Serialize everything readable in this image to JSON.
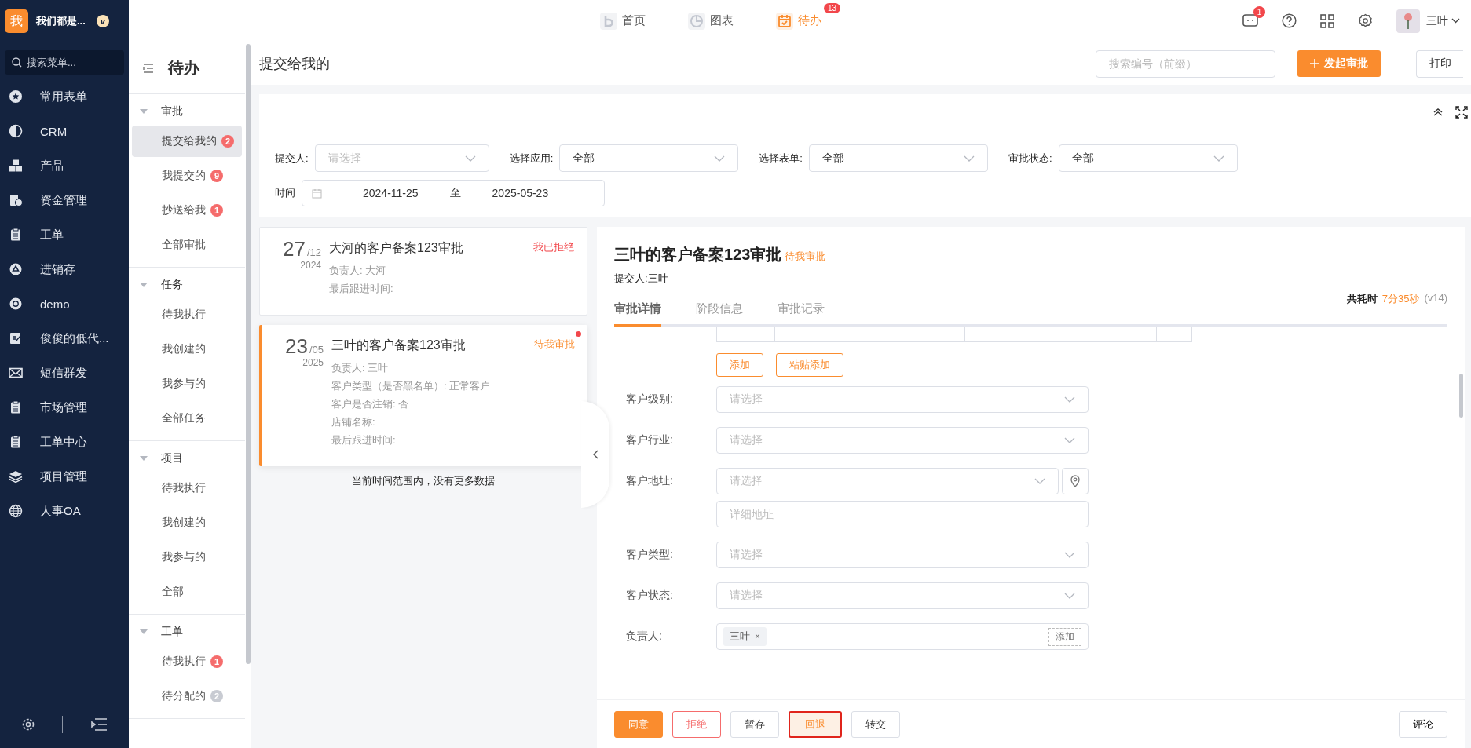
{
  "app": {
    "logo_char": "我",
    "name": "我们都是...",
    "badge": "v"
  },
  "menu_search": {
    "placeholder": "搜索菜单..."
  },
  "nav": [
    {
      "label": "常用表单",
      "kind": "star"
    },
    {
      "label": "CRM",
      "kind": "pie"
    },
    {
      "label": "产品",
      "kind": "boxes"
    },
    {
      "label": "资金管理",
      "kind": "money"
    },
    {
      "label": "工单",
      "kind": "clipboard"
    },
    {
      "label": "进销存",
      "kind": "cycle"
    },
    {
      "label": "demo",
      "kind": "aperture"
    },
    {
      "label": "俊俊的低代...",
      "kind": "edit"
    },
    {
      "label": "短信群发",
      "kind": "mail"
    },
    {
      "label": "市场管理",
      "kind": "clipboard"
    },
    {
      "label": "工单中心",
      "kind": "clipboard"
    },
    {
      "label": "项目管理",
      "kind": "layers"
    },
    {
      "label": "人事OA",
      "kind": "globe"
    }
  ],
  "top_tabs": [
    {
      "label": "首页",
      "kind": "home",
      "selected": false
    },
    {
      "label": "图表",
      "kind": "chart",
      "selected": false
    },
    {
      "label": "待办",
      "kind": "calendar",
      "selected": true,
      "badge": "13"
    }
  ],
  "header_right": {
    "message_badge": "1",
    "user": "三叶"
  },
  "subnav": {
    "title": "待办",
    "groups": [
      {
        "label": "审批",
        "expanded": true,
        "children": [
          {
            "label": "提交给我的",
            "selected": true,
            "badge": "2",
            "color": "#f56c6c"
          },
          {
            "label": "我提交的",
            "selected": false,
            "badge": "9",
            "color": "#f56c6c"
          },
          {
            "label": "抄送给我",
            "selected": false,
            "badge": "1",
            "color": "#f56c6c"
          },
          {
            "label": "全部审批",
            "selected": false
          }
        ]
      },
      {
        "label": "任务",
        "expanded": true,
        "children": [
          {
            "label": "待我执行",
            "selected": false
          },
          {
            "label": "我创建的",
            "selected": false
          },
          {
            "label": "我参与的",
            "selected": false
          },
          {
            "label": "全部任务",
            "selected": false
          }
        ]
      },
      {
        "label": "项目",
        "expanded": true,
        "children": [
          {
            "label": "待我执行",
            "selected": false
          },
          {
            "label": "我创建的",
            "selected": false
          },
          {
            "label": "我参与的",
            "selected": false
          },
          {
            "label": "全部",
            "selected": false
          }
        ]
      },
      {
        "label": "工单",
        "expanded": true,
        "children": [
          {
            "label": "待我执行",
            "selected": false,
            "badge": "1",
            "color": "#f56c6c"
          },
          {
            "label": "待分配的",
            "selected": false,
            "badge": "2",
            "color": "#c8cbd2"
          }
        ]
      }
    ]
  },
  "page_title": "提交给我的",
  "search": {
    "placeholder": "搜索编号（前缀）"
  },
  "start_button": "发起审批",
  "print_button": "打印",
  "filters": [
    {
      "label": "提交人:",
      "placeholder": "请选择"
    },
    {
      "label": "选择应用:",
      "value": "全部"
    },
    {
      "label": "选择表单:",
      "value": "全部"
    },
    {
      "label": "审批状态:",
      "value": "全部"
    }
  ],
  "time_filter": {
    "label": "时间",
    "start": "2024-11-25",
    "separator": "至",
    "end": "2025-05-23"
  },
  "cards": [
    {
      "day": "27",
      "month": "/12",
      "year": "2024",
      "title": "大河的客户备案123审批",
      "status": "我已拒绝",
      "color": "#f2474b",
      "selected": false,
      "unread": false,
      "fields": [
        "负责人: 大河",
        "最后跟进时间:"
      ]
    },
    {
      "day": "23",
      "month": "/05",
      "year": "2025",
      "title": "三叶的客户备案123审批",
      "status": "待我审批",
      "color": "#fa8c2e",
      "selected": true,
      "unread": true,
      "fields": [
        "负责人: 三叶",
        "客户类型（是否黑名单）: 正常客户",
        "客户是否注销: 否",
        "店铺名称:",
        "最后跟进时间:"
      ]
    }
  ],
  "list_end": "当前时间范围内，没有更多数据",
  "detail": {
    "title": "三叶的客户备案123审批",
    "status": "待我审批",
    "submitter": "提交人:三叶",
    "tabs": [
      {
        "label": "审批详情",
        "selected": true
      },
      {
        "label": "阶段信息",
        "selected": false
      },
      {
        "label": "审批记录",
        "selected": false
      }
    ],
    "elapsed_label": "共耗时",
    "elapsed": "7分35秒",
    "version": "(v14)",
    "table_buttons": [
      "添加",
      "粘贴添加"
    ],
    "form": [
      {
        "label": "客户级别:",
        "kind": "select",
        "placeholder": "请选择"
      },
      {
        "label": "客户行业:",
        "kind": "select",
        "placeholder": "请选择"
      },
      {
        "label": "客户地址:",
        "kind": "address",
        "placeholder": "请选择",
        "detail_placeholder": "详细地址"
      },
      {
        "label": "客户类型:",
        "kind": "select",
        "placeholder": "请选择"
      },
      {
        "label": "客户状态:",
        "kind": "select",
        "placeholder": "请选择"
      },
      {
        "label": "负责人:",
        "kind": "people",
        "tags": [
          {
            "name": "三叶",
            "remove": "×"
          }
        ],
        "add": "添加"
      }
    ],
    "actions": [
      {
        "label": "同意",
        "kind": "primary"
      },
      {
        "label": "拒绝",
        "kind": "danger"
      },
      {
        "label": "暂存",
        "kind": "default"
      },
      {
        "label": "回退",
        "kind": "focused"
      },
      {
        "label": "转交",
        "kind": "default"
      }
    ],
    "comment": "评论"
  }
}
